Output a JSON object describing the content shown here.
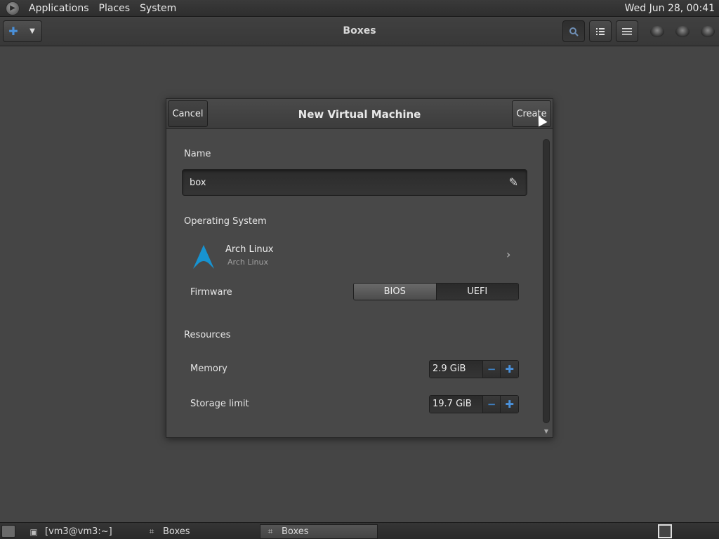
{
  "top_panel": {
    "menus": [
      "Applications",
      "Places",
      "System"
    ],
    "clock": "Wed Jun 28, 00:41"
  },
  "header": {
    "title": "Boxes",
    "new_icon": "plus-icon",
    "dropdown_icon": "chevron-down-icon",
    "search_icon": "search-icon",
    "list_icon": "list-view-icon",
    "menu_icon": "hamburger-menu-icon"
  },
  "dialog": {
    "title": "New Virtual Machine",
    "cancel_label": "Cancel",
    "create_label": "Create",
    "name_label": "Name",
    "name_value": "box",
    "os_section_label": "Operating System",
    "os_name": "Arch Linux",
    "os_subtitle": "Arch Linux",
    "firmware_label": "Firmware",
    "firmware_options": [
      "BIOS",
      "UEFI"
    ],
    "firmware_selected": "BIOS",
    "resources_label": "Resources",
    "memory_label": "Memory",
    "memory_value": "2.9 GiB",
    "storage_label": "Storage limit",
    "storage_value": "19.7 GiB"
  },
  "taskbar": {
    "tasks": [
      "[vm3@vm3:~]",
      "Boxes",
      "Boxes"
    ],
    "active_task_index": 2
  },
  "colors": {
    "accent": "#4a90d9",
    "arch_logo": "#1793d1",
    "background": "#454545"
  }
}
